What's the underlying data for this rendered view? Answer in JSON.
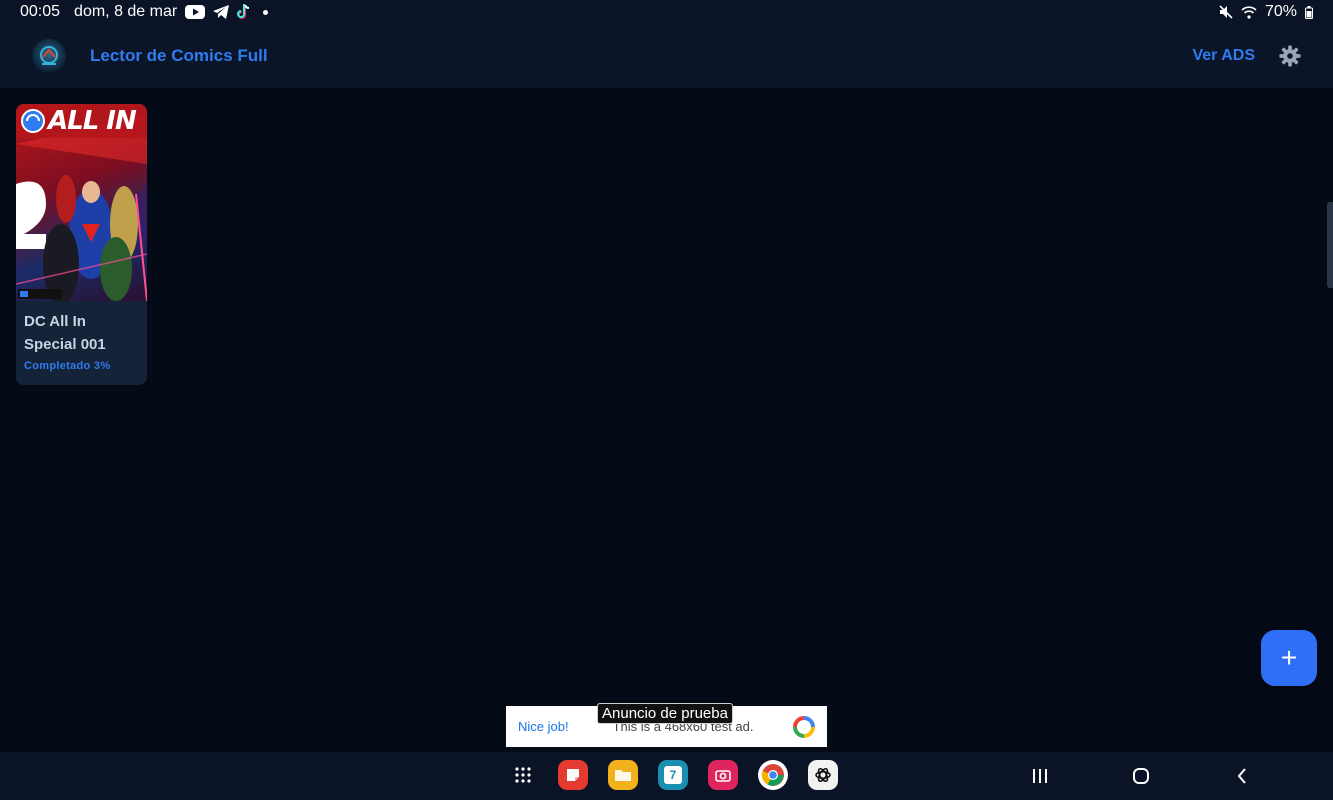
{
  "status_bar": {
    "time": "00:05",
    "date": "dom, 8 de mar",
    "battery": "70%"
  },
  "app_bar": {
    "title": "Lector de Comics Full",
    "ver_ads": "Ver ADS"
  },
  "comics": [
    {
      "title": "DC All In Special 001",
      "progress": "Completado 3%",
      "progress_value": 0.03
    }
  ],
  "fab": {
    "label": "+"
  },
  "ad": {
    "label": "Anuncio de prueba",
    "nice": "Nice job!",
    "text": "This is a 468x60 test ad."
  },
  "dock": {
    "calendar_day": "7"
  },
  "colors": {
    "accent": "#2f7bf0",
    "background": "#050a17",
    "appbar": "#0b1528",
    "card": "#152338",
    "fab": "#2f6ff7"
  }
}
